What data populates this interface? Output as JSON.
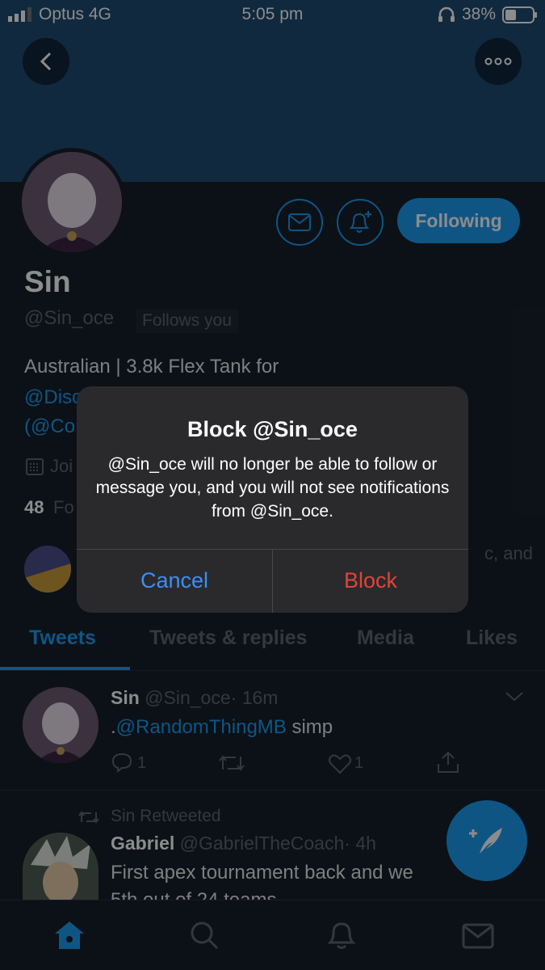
{
  "status_bar": {
    "carrier": "Optus 4G",
    "time": "5:05 pm",
    "battery": "38%"
  },
  "profile": {
    "name": "Sin",
    "handle": "@Sin_oce",
    "follows_you": "Follows you",
    "bio_line1": "Australian | 3.8k Flex Tank for",
    "bio_link1": "@Disc",
    "bio_link2": "(@Co",
    "joined_partial": "Joi",
    "following_count": "48",
    "following_label_partial": "Fo",
    "followed_by_partial": "c, and",
    "following_button": "Following"
  },
  "dialog": {
    "title": "Block @Sin_oce",
    "message": "@Sin_oce will no longer be able to follow or message you, and you will not see notifications from @Sin_oce.",
    "cancel": "Cancel",
    "confirm": "Block"
  },
  "tabs": [
    "Tweets",
    "Tweets & replies",
    "Media",
    "Likes"
  ],
  "tweets": [
    {
      "name": "Sin",
      "handle": "@Sin_oce",
      "time": "· 16m",
      "prefix": ".",
      "mention": "@RandomThingMB",
      "text": " simp",
      "reply_count": "1",
      "like_count": "1"
    },
    {
      "retweeted_by": "Sin Retweeted",
      "name": "Gabriel",
      "handle": "@GabrielTheCoach",
      "time": "· 4h",
      "text_line1": "First apex tournament back and we",
      "text_line2_partial": "5th out of 24 teams"
    }
  ],
  "colors": {
    "accent": "#1d9bf0",
    "background": "#15202b",
    "danger": "#e0443a"
  }
}
